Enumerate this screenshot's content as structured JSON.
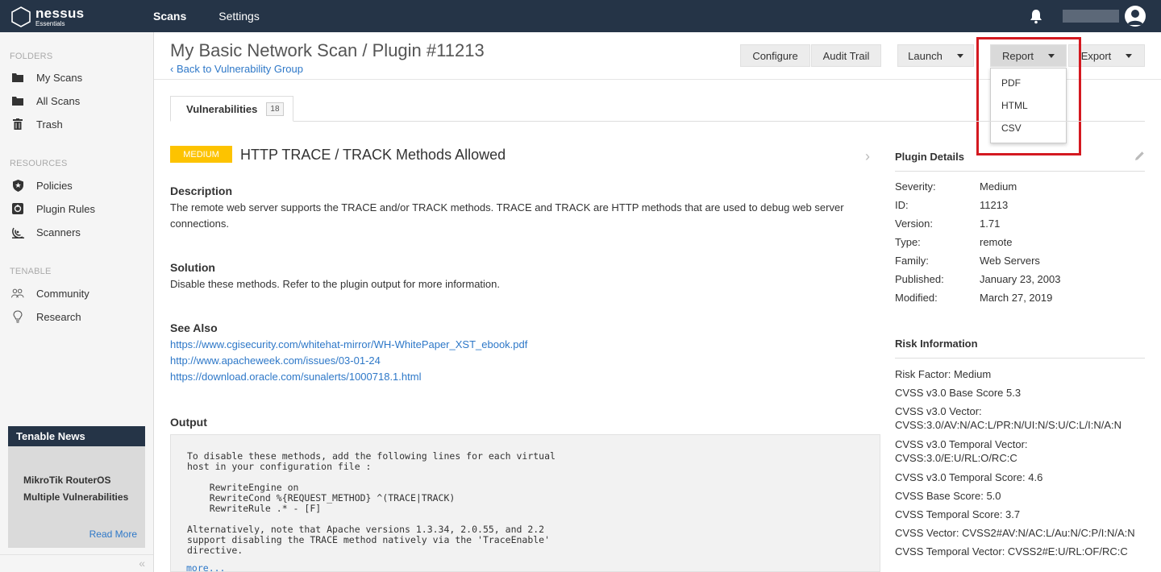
{
  "brand": {
    "name": "nessus",
    "edition": "Essentials"
  },
  "topnav": {
    "scans": "Scans",
    "settings": "Settings"
  },
  "sidebar": {
    "folders_title": "FOLDERS",
    "folders": [
      "My Scans",
      "All Scans",
      "Trash"
    ],
    "resources_title": "RESOURCES",
    "resources": [
      "Policies",
      "Plugin Rules",
      "Scanners"
    ],
    "tenable_title": "TENABLE",
    "tenable": [
      "Community",
      "Research"
    ],
    "news": {
      "title": "Tenable News",
      "headline_line1": "MikroTik RouterOS",
      "headline_line2": "Multiple Vulnerabilities",
      "read_more": "Read More"
    },
    "collapse": "«"
  },
  "header": {
    "title": "My Basic Network Scan / Plugin #11213",
    "back": "‹ Back to Vulnerability Group",
    "buttons": {
      "configure": "Configure",
      "audit_trail": "Audit Trail",
      "launch": "Launch",
      "report": "Report",
      "export": "Export"
    },
    "report_menu": [
      "PDF",
      "HTML",
      "CSV"
    ]
  },
  "tabs": {
    "vulnerabilities": "Vulnerabilities",
    "count": "18"
  },
  "vuln": {
    "severity": "MEDIUM",
    "title": "HTTP TRACE / TRACK Methods Allowed",
    "description_heading": "Description",
    "description": "The remote web server supports the TRACE and/or TRACK methods. TRACE and TRACK are HTTP methods that are used to debug web server connections.",
    "solution_heading": "Solution",
    "solution": "Disable these methods. Refer to the plugin output for more information.",
    "see_also_heading": "See Also",
    "see_also": [
      "https://www.cgisecurity.com/whitehat-mirror/WH-WhitePaper_XST_ebook.pdf",
      "http://www.apacheweek.com/issues/03-01-24",
      "https://download.oracle.com/sunalerts/1000718.1.html"
    ],
    "output_heading": "Output",
    "output": "To disable these methods, add the following lines for each virtual\nhost in your configuration file :\n\n    RewriteEngine on\n    RewriteCond %{REQUEST_METHOD} ^(TRACE|TRACK)\n    RewriteRule .* - [F]\n\nAlternatively, note that Apache versions 1.3.34, 2.0.55, and 2.2\nsupport disabling the TRACE method natively via the 'TraceEnable'\ndirective.",
    "more": "more..."
  },
  "plugin_details": {
    "title": "Plugin Details",
    "rows": [
      {
        "label": "Severity:",
        "value": "Medium"
      },
      {
        "label": "ID:",
        "value": "11213"
      },
      {
        "label": "Version:",
        "value": "1.71"
      },
      {
        "label": "Type:",
        "value": "remote"
      },
      {
        "label": "Family:",
        "value": "Web Servers"
      },
      {
        "label": "Published:",
        "value": "January 23, 2003"
      },
      {
        "label": "Modified:",
        "value": "March 27, 2019"
      }
    ]
  },
  "risk": {
    "title": "Risk Information",
    "factor": "Risk Factor: Medium",
    "cvss3_base": "CVSS v3.0 Base Score 5.3",
    "cvss3_vector_label": "CVSS v3.0 Vector:",
    "cvss3_vector": "CVSS:3.0/AV:N/AC:L/PR:N/UI:N/S:U/C:L/I:N/A:N",
    "cvss3_temporal_vector_label": "CVSS v3.0 Temporal Vector:",
    "cvss3_temporal_vector": "CVSS:3.0/E:U/RL:O/RC:C",
    "cvss3_temporal_score": "CVSS v3.0 Temporal Score: 4.6",
    "cvss_base": "CVSS Base Score: 5.0",
    "cvss_temporal": "CVSS Temporal Score: 3.7",
    "cvss_vector": "CVSS Vector: CVSS2#AV:N/AC:L/Au:N/C:P/I:N/A:N",
    "cvss_temporal_vector": "CVSS Temporal Vector: CVSS2#E:U/RL:OF/RC:C"
  },
  "colors": {
    "topbar": "#253447",
    "medium": "#fdc300",
    "link": "#2e78c8",
    "highlight": "#d41920"
  }
}
